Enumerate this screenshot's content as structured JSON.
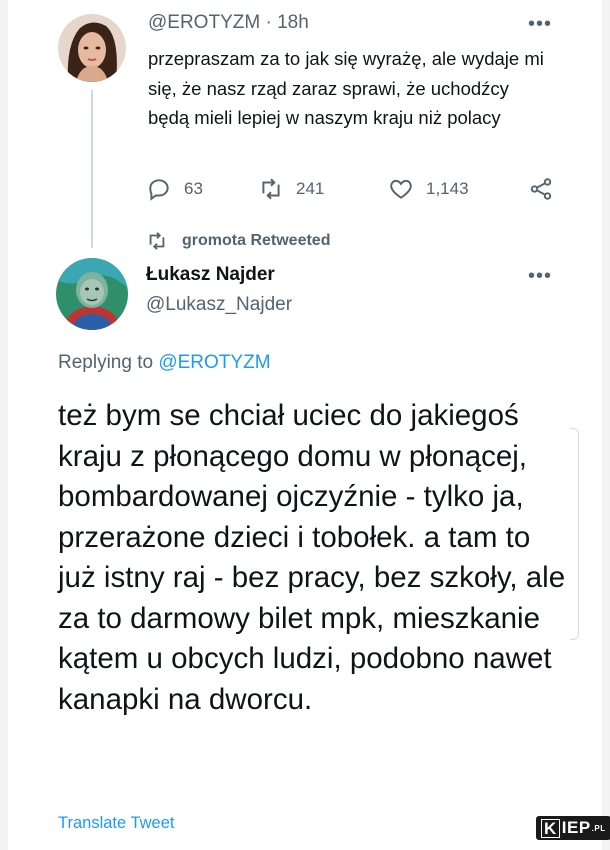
{
  "tweet1": {
    "handle": "@EROTYZM",
    "separator": "·",
    "time": "18h",
    "text": "przepraszam za to jak się wyrażę, ale wydaje mi się, że nasz rząd zaraz sprawi, że uchodźcy będą mieli lepiej w naszym kraju niż polacy",
    "actions": {
      "replies": "63",
      "retweets": "241",
      "likes": "1,143"
    }
  },
  "retweet_note": "gromota Retweeted",
  "tweet2": {
    "name": "Łukasz Najder",
    "handle": "@Lukasz_Najder",
    "replying_prefix": "Replying to",
    "replying_to": "@EROTYZM",
    "text": "też bym se chciał uciec do jakiegoś kraju z płonącego domu w płonącej, bombardowanej ojczyźnie - tylko ja, przerażone dzieci i tobołek. a tam to już istny raj - bez pracy, bez szkoły, ale za to darmowy bilet mpk, mieszkanie kątem u obcych ludzi, podobno nawet kanapki na dworcu.",
    "translate_label": "Translate Tweet"
  },
  "watermark": {
    "k": "K",
    "text": "IEP",
    "suffix": ".PL"
  },
  "colors": {
    "text": "#0f1419",
    "secondary": "#536471",
    "link": "#1d9bf0",
    "background": "#ffffff"
  }
}
